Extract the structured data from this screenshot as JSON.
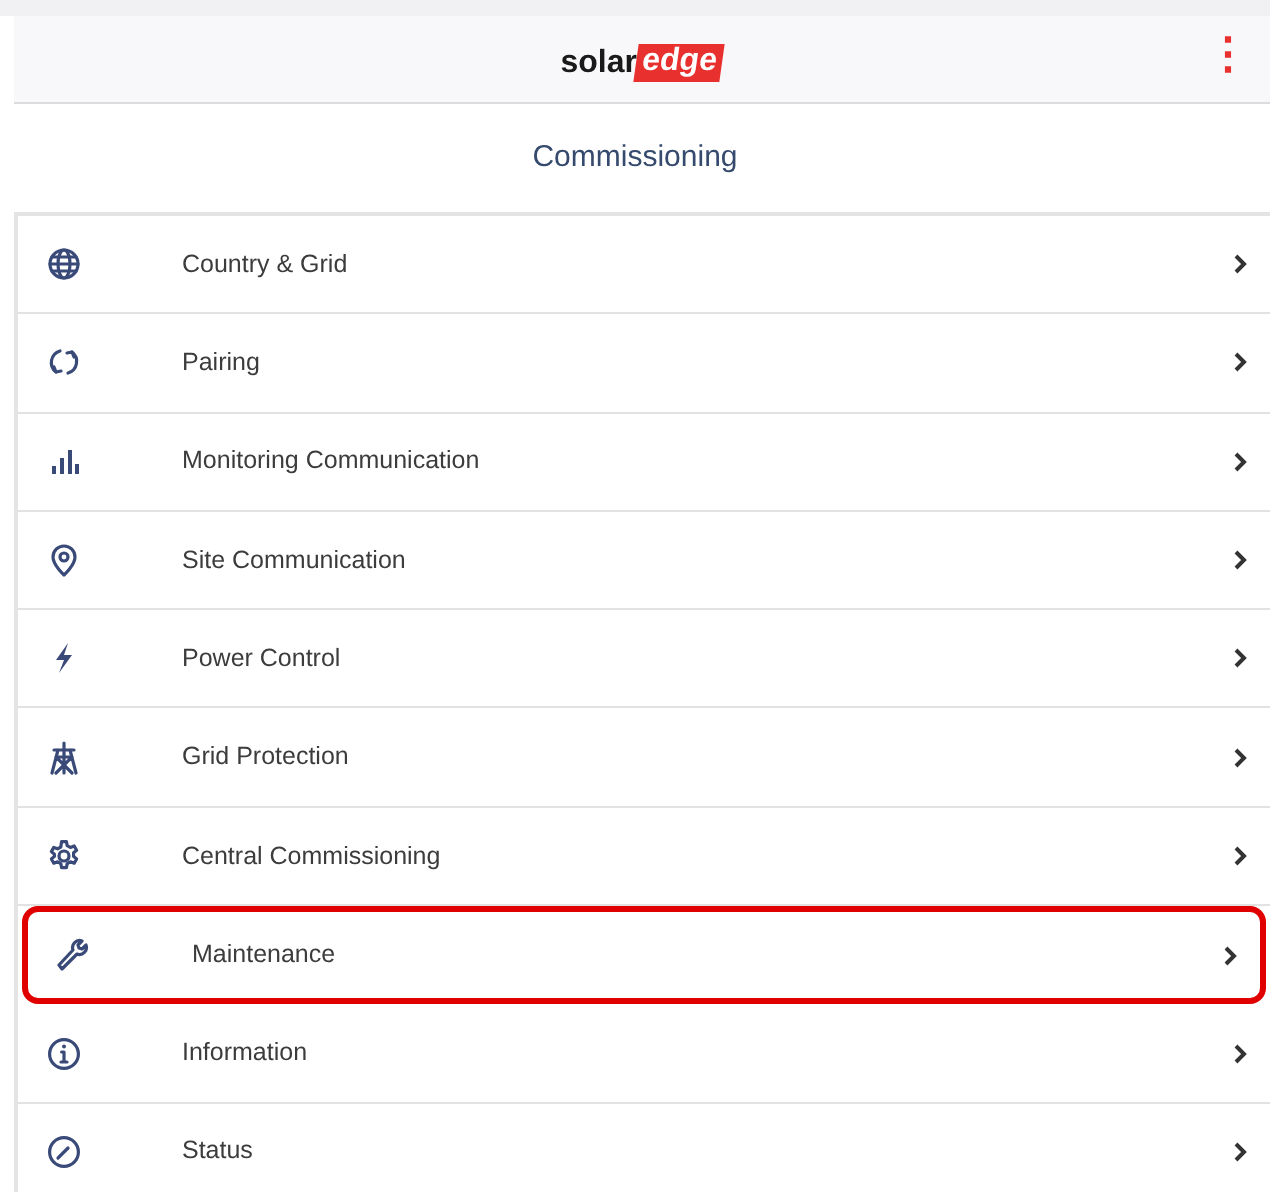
{
  "header": {
    "logo": {
      "first": "solar",
      "second": "edge"
    },
    "menu_icon": "⋮"
  },
  "title": "Commissioning",
  "menu": [
    {
      "label": "Country & Grid",
      "highlighted": false
    },
    {
      "label": "Pairing",
      "highlighted": false
    },
    {
      "label": "Monitoring Communication",
      "highlighted": false
    },
    {
      "label": "Site Communication",
      "highlighted": false
    },
    {
      "label": "Power Control",
      "highlighted": false
    },
    {
      "label": "Grid Protection",
      "highlighted": false
    },
    {
      "label": "Central Commissioning",
      "highlighted": false
    },
    {
      "label": "Maintenance",
      "highlighted": true
    },
    {
      "label": "Information",
      "highlighted": false
    },
    {
      "label": "Status",
      "highlighted": false
    }
  ]
}
